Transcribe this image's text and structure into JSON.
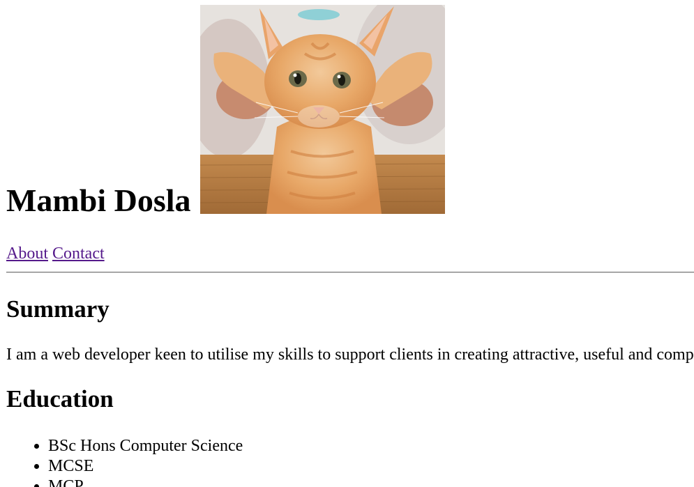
{
  "header": {
    "name": "Mambi Dosla",
    "photo": "kitten-photo"
  },
  "nav": {
    "about": "About",
    "contact": "Contact"
  },
  "summary": {
    "heading": "Summary",
    "text": "I am a web developer keen to utilise my skills to support clients in creating attractive, useful and comp"
  },
  "education": {
    "heading": "Education",
    "items": [
      "BSc Hons Computer Science",
      "MCSE",
      "MCP"
    ]
  },
  "colors": {
    "link": "#551a8b",
    "text": "#000000"
  }
}
